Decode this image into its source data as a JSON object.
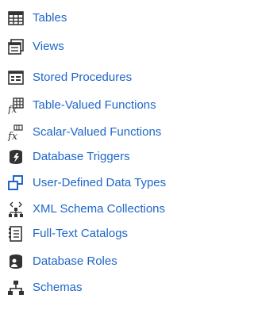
{
  "links": [
    {
      "label": "Tables",
      "icon": "table-icon"
    },
    {
      "label": "Views",
      "icon": "view-icon"
    },
    {
      "label": "Stored Procedures",
      "icon": "stored-procedure-icon"
    },
    {
      "label": "Table-Valued Functions",
      "icon": "table-valued-function-icon"
    },
    {
      "label": "Scalar-Valued Functions",
      "icon": "scalar-valued-function-icon"
    },
    {
      "label": "Database Triggers",
      "icon": "database-trigger-icon"
    },
    {
      "label": "User-Defined Data Types",
      "icon": "user-defined-type-icon"
    },
    {
      "label": "XML Schema Collections",
      "icon": "xml-schema-icon"
    },
    {
      "label": "Full-Text Catalogs",
      "icon": "full-text-catalog-icon"
    },
    {
      "label": "Database Roles",
      "icon": "database-role-icon"
    },
    {
      "label": "Schemas",
      "icon": "schema-icon"
    }
  ],
  "colors": {
    "link": "#1f66c8",
    "icon_dark": "#333333",
    "icon_accent": "#1f66c8"
  }
}
